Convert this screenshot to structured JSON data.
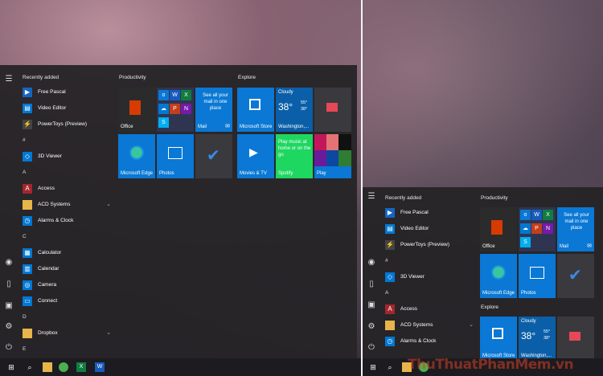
{
  "left": {
    "section_title": "Recently added",
    "recent": [
      {
        "label": "Free Pascal",
        "icon": "pascal-icon",
        "color": "#1565c0"
      },
      {
        "label": "Video Editor",
        "icon": "video-editor-icon",
        "color": "#0078d4"
      },
      {
        "label": "PowerToys (Preview)",
        "icon": "powertoys-icon",
        "color": "#333"
      }
    ],
    "letters": [
      "#",
      "A",
      "C",
      "D",
      "E"
    ],
    "apps": [
      {
        "label": "3D Viewer",
        "icon": "3d-viewer-icon",
        "color": "#0078d4"
      },
      {
        "label": "Access",
        "icon": "access-icon",
        "color": "#a4262c"
      },
      {
        "label": "ACD Systems",
        "icon": "folder-icon",
        "color": "#e8b54a",
        "expand": "⌄"
      },
      {
        "label": "Alarms & Clock",
        "icon": "alarm-clock-icon",
        "color": "#0078d4"
      },
      {
        "label": "Calculator",
        "icon": "calculator-icon",
        "color": "#0078d4"
      },
      {
        "label": "Calendar",
        "icon": "calendar-icon",
        "color": "#0078d4"
      },
      {
        "label": "Camera",
        "icon": "camera-icon",
        "color": "#0078d4"
      },
      {
        "label": "Connect",
        "icon": "connect-icon",
        "color": "#0078d4"
      },
      {
        "label": "Dropbox",
        "icon": "folder-icon",
        "color": "#e8b54a",
        "expand": "⌄"
      }
    ],
    "productivity": "Productivity",
    "explore": "Explore",
    "tiles": {
      "office": "Office",
      "mail_text": "See all your mail in one place",
      "mail": "Mail",
      "edge": "Microsoft Edge",
      "photos": "Photos",
      "store": "Microsoft Store",
      "weather_title": "Cloudy",
      "temp": "38°",
      "hi": "55°",
      "lo": "38°",
      "city": "Washington,...",
      "spotify_text": "Play music at home or on the go",
      "spotify": "Spotify",
      "movies": "Movies & TV",
      "play": "Play"
    }
  },
  "right": {
    "section_title": "Recently added",
    "recent": [
      {
        "label": "Free Pascal",
        "icon": "pascal-icon",
        "color": "#1565c0"
      },
      {
        "label": "Video Editor",
        "icon": "video-editor-icon",
        "color": "#0078d4"
      },
      {
        "label": "PowerToys (Preview)",
        "icon": "powertoys-icon",
        "color": "#333"
      }
    ],
    "letters": [
      "#",
      "A"
    ],
    "apps": [
      {
        "label": "3D Viewer",
        "icon": "3d-viewer-icon",
        "color": "#0078d4"
      },
      {
        "label": "Access",
        "icon": "access-icon",
        "color": "#a4262c"
      },
      {
        "label": "ACD Systems",
        "icon": "folder-icon",
        "color": "#e8b54a",
        "expand": "⌄"
      },
      {
        "label": "Alarms & Clock",
        "icon": "alarm-clock-icon",
        "color": "#0078d4"
      }
    ],
    "productivity": "Productivity",
    "explore": "Explore",
    "tiles": {
      "office": "Office",
      "mail_text": "See all your mail in one place",
      "mail": "Mail",
      "edge": "Microsoft Edge",
      "photos": "Photos",
      "store": "Microsoft Store",
      "weather_title": "Cloudy",
      "temp": "38°",
      "hi": "55°",
      "lo": "38°",
      "city": "Washington,..."
    }
  },
  "watermark": "ThuThuatPhanMem.vn",
  "colors": {
    "accent": "#0078d4",
    "tile_blue": "#0a78d4",
    "spotify": "#1ed760",
    "office": "#2b2b2b",
    "menu_bg": "#262428"
  }
}
